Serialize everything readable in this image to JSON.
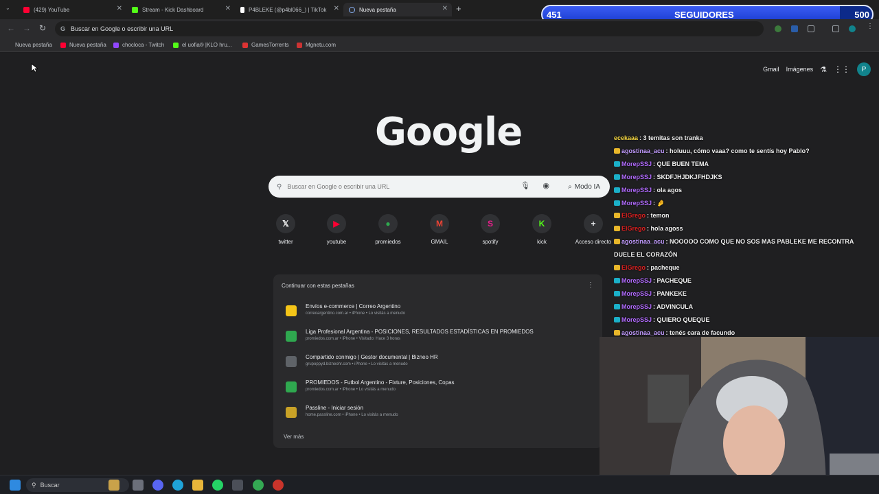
{
  "tabs": [
    {
      "label": "(429) YouTube",
      "color": "#ff0033"
    },
    {
      "label": "Stream - Kick Dashboard",
      "color": "#53fc18"
    },
    {
      "label": "P4BLEKE (@p4bl066_) | TikTok",
      "color": "#ffffff"
    },
    {
      "label": "Nueva pestaña",
      "color": "#8ab4f8"
    }
  ],
  "toolbar": {
    "address_placeholder": "Buscar en Google o escribir una URL"
  },
  "bookmarks": [
    {
      "label": "Nueva pestaña",
      "color": "#8ab4f8"
    },
    {
      "label": "Nueva pestaña",
      "color": "#ff0033"
    },
    {
      "label": "chocloca - Twitch",
      "color": "#9146ff"
    },
    {
      "label": "el uofia® |KLO hru...",
      "color": "#53fc18"
    },
    {
      "label": "GamesTorrents",
      "color": "#d33"
    },
    {
      "label": "Mgnetu.com",
      "color": "#c33"
    }
  ],
  "header": {
    "gmail": "Gmail",
    "images": "Imágenes",
    "avatar_letter": "P"
  },
  "logo": "Google",
  "search": {
    "placeholder": "Buscar en Google o escribir una URL",
    "modo_ia": "Modo IA"
  },
  "shortcuts": [
    {
      "label": "twitter",
      "glyph": "𝕏",
      "color": "#ffffff",
      "icon": "x-icon"
    },
    {
      "label": "youtube",
      "glyph": "▶",
      "color": "#ff0033",
      "icon": "youtube-icon"
    },
    {
      "label": "promiedos",
      "glyph": "●",
      "color": "#2fa84f",
      "icon": "promiedos-icon"
    },
    {
      "label": "GMAIL",
      "glyph": "M",
      "color": "#ea4335",
      "icon": "gmail-icon"
    },
    {
      "label": "spotify",
      "glyph": "S",
      "color": "#e91e8c",
      "icon": "spotify-icon"
    },
    {
      "label": "kick",
      "glyph": "K",
      "color": "#53fc18",
      "icon": "kick-icon"
    },
    {
      "label": "Acceso directo",
      "glyph": "+",
      "color": "#e8eaed",
      "icon": "plus-icon"
    }
  ],
  "continue": {
    "title": "Continuar con estas pestañas",
    "items": [
      {
        "title": "Envíos e-commerce | Correo Argentino",
        "sub": "correoargentino.com.ar • iPhone • Lo visitás a menudo",
        "color": "#f5c518"
      },
      {
        "title": "Liga Profesional Argentina - POSICIONES, RESULTADOS ESTADÍSTICAS EN PROMIEDOS",
        "sub": "promiedos.com.ar • iPhone • Visitado: Hace 3 horas",
        "color": "#2fa84f"
      },
      {
        "title": "Compartido conmigo | Gestor documental | Bizneo HR",
        "sub": "grupoppyd.bizneohr.com • iPhone • Lo visitás a menudo",
        "color": "#5f6368"
      },
      {
        "title": "PROMIEDOS - Futbol Argentino - Fixture, Posiciones, Copas",
        "sub": "promiedos.com.ar • iPhone • Lo visitás a menudo",
        "color": "#2fa84f"
      },
      {
        "title": "Passline - Iniciar sesión",
        "sub": "home.passline.com • iPhone • Lo visitás a menudo",
        "color": "#c9a227"
      }
    ],
    "more": "Ver más"
  },
  "followers": {
    "current": "451",
    "label": "SEGUIDORES",
    "goal": "500",
    "progress": 0.902
  },
  "chat": [
    {
      "user": "ecekaaa",
      "text": ": 3 temitas son tranka",
      "color": "#f5d742",
      "badge": ""
    },
    {
      "user": "agostinaa_acu",
      "text": ": holuuu, cómo vaaa? como te sentís hoy Pablo?",
      "color": "#c29cff",
      "badge": "#e9b72a"
    },
    {
      "user": "MorepSSJ",
      "text": ": QUE BUEN TEMA",
      "color": "#b26bff",
      "badge": "#1bb0c9"
    },
    {
      "user": "MorepSSJ",
      "text": ": SKDFJHJDKJFHDJKS",
      "color": "#b26bff",
      "badge": "#1bb0c9"
    },
    {
      "user": "MorepSSJ",
      "text": ": ola agos",
      "color": "#b26bff",
      "badge": "#1bb0c9"
    },
    {
      "user": "MorepSSJ",
      "text": ": 🤌",
      "color": "#b26bff",
      "badge": "#1bb0c9"
    },
    {
      "user": "ElGrego",
      "text": ": temon",
      "color": "#e02020",
      "badge": "#e9b72a"
    },
    {
      "user": "ElGrego",
      "text": ": hola agoss",
      "color": "#e02020",
      "badge": "#e9b72a"
    },
    {
      "user": "agostinaa_acu",
      "text": ": NOOOOO COMO QUE NO SOS MAS PABLEKE ME RECONTRA",
      "color": "#c29cff",
      "badge": "#e9b72a"
    },
    {
      "user": "",
      "text": "DUELE EL CORAZÓN",
      "color": "#c29cff",
      "badge": ""
    },
    {
      "user": "ElGrego",
      "text": ": pacheque",
      "color": "#e02020",
      "badge": "#e9b72a"
    },
    {
      "user": "MorepSSJ",
      "text": ": PACHEQUE",
      "color": "#b26bff",
      "badge": "#1bb0c9"
    },
    {
      "user": "MorepSSJ",
      "text": ": PANKEKE",
      "color": "#b26bff",
      "badge": "#1bb0c9"
    },
    {
      "user": "MorepSSJ",
      "text": ": ADVINCULA",
      "color": "#b26bff",
      "badge": "#1bb0c9"
    },
    {
      "user": "MorepSSJ",
      "text": ": QUIERO QUEQUE",
      "color": "#b26bff",
      "badge": "#1bb0c9"
    },
    {
      "user": "agostinaa_acu",
      "text": ": tenés cara de facundo",
      "color": "#c29cff",
      "badge": "#e9b72a"
    }
  ],
  "taskbar": {
    "search": "Buscar"
  }
}
